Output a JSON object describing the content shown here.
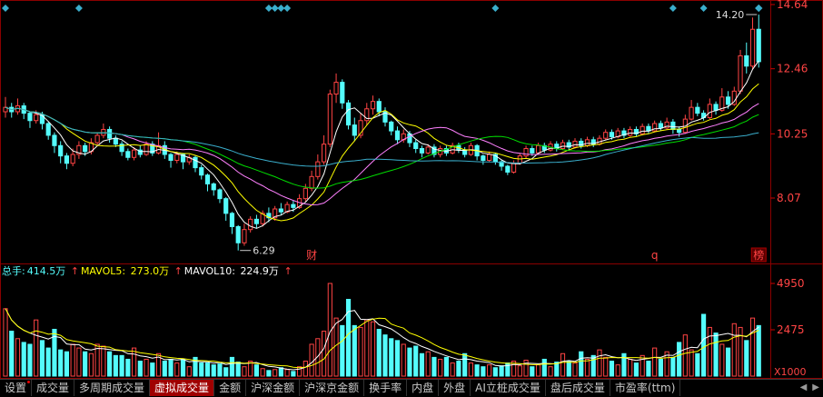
{
  "chart_data": {
    "type": "candlestick",
    "price_axis": {
      "ticks": [
        14.64,
        12.46,
        10.25,
        8.07
      ],
      "labels": [
        "14.64",
        "12.46",
        "10.25",
        "8.07"
      ]
    },
    "volume_axis": {
      "ticks": [
        4950,
        2475
      ],
      "labels": [
        "4950",
        "2475"
      ],
      "unit_label": "X1000"
    },
    "annotations": {
      "high_label": "14.20",
      "low_label": "6.29",
      "marker_cai": "财",
      "marker_q": "q",
      "marker_bang": "榜"
    },
    "colors": {
      "up": "#ff4444",
      "down": "#54fcfc",
      "ma5": "#ffffff",
      "ma10": "#ffff00",
      "ma20": "#ff80ff",
      "ma30": "#00dd00",
      "ma60": "#3aaecc"
    },
    "candles": [
      [
        11.0,
        11.15,
        11.5,
        10.8
      ],
      [
        11.15,
        11.0,
        11.3,
        10.8
      ],
      [
        11.0,
        11.2,
        11.45,
        10.9
      ],
      [
        11.2,
        10.95,
        11.3,
        10.75
      ],
      [
        10.95,
        10.7,
        11.0,
        10.45
      ],
      [
        10.7,
        10.9,
        11.05,
        10.6
      ],
      [
        10.9,
        10.6,
        11.0,
        10.4
      ],
      [
        10.6,
        10.2,
        10.65,
        10.05
      ],
      [
        10.2,
        9.85,
        10.3,
        9.6
      ],
      [
        9.85,
        9.5,
        10.0,
        9.25
      ],
      [
        9.5,
        9.25,
        9.6,
        9.05
      ],
      [
        9.25,
        9.55,
        9.75,
        9.15
      ],
      [
        9.55,
        9.85,
        10.0,
        9.4
      ],
      [
        9.85,
        9.65,
        9.95,
        9.5
      ],
      [
        9.65,
        9.95,
        10.1,
        9.55
      ],
      [
        9.95,
        10.2,
        10.3,
        9.85
      ],
      [
        10.2,
        10.4,
        10.6,
        10.1
      ],
      [
        10.4,
        10.1,
        10.5,
        9.95
      ],
      [
        10.1,
        9.9,
        10.2,
        9.8
      ],
      [
        9.9,
        9.65,
        10.0,
        9.5
      ],
      [
        9.65,
        9.45,
        9.75,
        9.35
      ],
      [
        9.45,
        9.7,
        9.8,
        9.35
      ],
      [
        9.7,
        9.55,
        9.85,
        9.45
      ],
      [
        9.55,
        9.9,
        10.0,
        9.5
      ],
      [
        9.9,
        9.6,
        10.0,
        9.5
      ],
      [
        9.6,
        9.85,
        10.3,
        9.55
      ],
      [
        9.85,
        9.55,
        10.0,
        9.4
      ],
      [
        9.55,
        9.35,
        9.6,
        9.1
      ],
      [
        9.35,
        9.55,
        9.65,
        9.25
      ],
      [
        9.55,
        9.3,
        9.6,
        9.05
      ],
      [
        9.3,
        9.45,
        9.55,
        9.2
      ],
      [
        9.45,
        9.1,
        9.5,
        8.95
      ],
      [
        9.1,
        8.85,
        9.2,
        8.7
      ],
      [
        8.85,
        8.55,
        8.9,
        8.3
      ],
      [
        8.55,
        8.35,
        8.6,
        8.15
      ],
      [
        8.35,
        8.05,
        8.4,
        7.9
      ],
      [
        8.05,
        7.55,
        8.1,
        7.3
      ],
      [
        7.55,
        7.1,
        7.6,
        6.85
      ],
      [
        7.1,
        6.55,
        7.15,
        6.29
      ],
      [
        6.55,
        7.0,
        7.2,
        6.45
      ],
      [
        7.0,
        7.35,
        7.45,
        6.9
      ],
      [
        7.35,
        7.2,
        7.5,
        7.05
      ],
      [
        7.2,
        7.55,
        7.65,
        7.1
      ],
      [
        7.55,
        7.4,
        7.75,
        7.25
      ],
      [
        7.4,
        7.7,
        7.8,
        7.3
      ],
      [
        7.7,
        7.6,
        7.9,
        7.5
      ],
      [
        7.6,
        7.85,
        7.95,
        7.55
      ],
      [
        7.85,
        7.75,
        8.0,
        7.6
      ],
      [
        7.75,
        8.05,
        8.2,
        7.7
      ],
      [
        8.05,
        8.4,
        8.55,
        7.95
      ],
      [
        8.4,
        8.8,
        9.0,
        8.3
      ],
      [
        8.8,
        9.3,
        9.55,
        8.7
      ],
      [
        9.3,
        9.9,
        10.2,
        9.2
      ],
      [
        9.9,
        11.6,
        11.75,
        9.8
      ],
      [
        11.6,
        12.0,
        12.3,
        11.3
      ],
      [
        12.0,
        11.3,
        12.1,
        11.1
      ],
      [
        11.3,
        10.55,
        11.4,
        10.4
      ],
      [
        10.55,
        10.2,
        10.8,
        10.0
      ],
      [
        10.2,
        10.7,
        10.95,
        10.1
      ],
      [
        10.7,
        11.1,
        11.3,
        10.55
      ],
      [
        11.1,
        11.35,
        11.55,
        10.9
      ],
      [
        11.35,
        11.0,
        11.45,
        10.85
      ],
      [
        11.0,
        10.65,
        11.15,
        10.5
      ],
      [
        10.65,
        10.35,
        10.7,
        10.2
      ],
      [
        10.35,
        10.05,
        10.5,
        9.9
      ],
      [
        10.05,
        10.25,
        10.4,
        9.95
      ],
      [
        10.25,
        9.95,
        10.35,
        9.8
      ],
      [
        9.95,
        9.75,
        10.05,
        9.6
      ],
      [
        9.75,
        9.6,
        9.85,
        9.45
      ],
      [
        9.6,
        9.8,
        9.9,
        9.55
      ],
      [
        9.8,
        9.55,
        9.9,
        9.45
      ],
      [
        9.55,
        9.75,
        9.85,
        9.45
      ],
      [
        9.75,
        9.6,
        9.85,
        9.5
      ],
      [
        9.6,
        9.85,
        9.95,
        9.55
      ],
      [
        9.85,
        9.7,
        9.95,
        9.6
      ],
      [
        9.7,
        9.55,
        9.8,
        9.45
      ],
      [
        9.55,
        9.85,
        9.95,
        9.5
      ],
      [
        9.85,
        9.5,
        9.9,
        9.35
      ],
      [
        9.5,
        9.35,
        9.55,
        9.2
      ],
      [
        9.35,
        9.55,
        9.65,
        9.3
      ],
      [
        9.55,
        9.3,
        9.6,
        9.2
      ],
      [
        9.3,
        9.15,
        9.35,
        9.0
      ],
      [
        9.15,
        8.95,
        9.2,
        8.85
      ],
      [
        8.95,
        9.25,
        9.35,
        8.9
      ],
      [
        9.25,
        9.5,
        9.6,
        9.2
      ],
      [
        9.5,
        9.75,
        9.85,
        9.4
      ],
      [
        9.75,
        9.6,
        9.85,
        9.5
      ],
      [
        9.6,
        9.85,
        9.95,
        9.55
      ],
      [
        9.85,
        9.7,
        9.95,
        9.6
      ],
      [
        9.7,
        9.9,
        10.0,
        9.65
      ],
      [
        9.9,
        9.75,
        10.0,
        9.65
      ],
      [
        9.75,
        9.95,
        10.05,
        9.7
      ],
      [
        9.95,
        9.8,
        10.05,
        9.7
      ],
      [
        9.8,
        10.0,
        10.1,
        9.75
      ],
      [
        10.0,
        9.85,
        10.1,
        9.75
      ],
      [
        9.85,
        10.05,
        10.15,
        9.8
      ],
      [
        10.05,
        9.9,
        10.15,
        9.8
      ],
      [
        9.9,
        10.1,
        10.2,
        9.85
      ],
      [
        10.1,
        10.3,
        10.4,
        10.05
      ],
      [
        10.3,
        10.15,
        10.4,
        10.05
      ],
      [
        10.15,
        10.35,
        10.45,
        10.1
      ],
      [
        10.35,
        10.2,
        10.45,
        10.1
      ],
      [
        10.2,
        10.4,
        10.5,
        10.15
      ],
      [
        10.4,
        10.25,
        10.5,
        10.15
      ],
      [
        10.25,
        10.5,
        10.6,
        10.2
      ],
      [
        10.5,
        10.35,
        10.6,
        10.25
      ],
      [
        10.35,
        10.6,
        10.7,
        10.3
      ],
      [
        10.6,
        10.45,
        10.7,
        10.35
      ],
      [
        10.45,
        10.65,
        10.8,
        10.4
      ],
      [
        10.65,
        10.4,
        10.75,
        10.25
      ],
      [
        10.4,
        10.3,
        10.5,
        10.15
      ],
      [
        10.3,
        10.75,
        10.9,
        10.25
      ],
      [
        10.75,
        11.15,
        11.4,
        10.7
      ],
      [
        11.15,
        10.95,
        11.3,
        10.85
      ],
      [
        10.95,
        10.8,
        11.05,
        10.7
      ],
      [
        10.8,
        11.25,
        11.45,
        10.75
      ],
      [
        11.25,
        11.05,
        11.35,
        10.9
      ],
      [
        11.05,
        11.5,
        11.8,
        11.0
      ],
      [
        11.5,
        11.25,
        11.7,
        11.1
      ],
      [
        11.25,
        11.7,
        11.85,
        11.2
      ],
      [
        11.7,
        12.9,
        13.1,
        11.6
      ],
      [
        12.9,
        12.55,
        13.35,
        12.3
      ],
      [
        12.55,
        13.8,
        14.2,
        12.45
      ],
      [
        13.8,
        12.7,
        14.3,
        12.5
      ]
    ],
    "volumes": [
      3600,
      2400,
      2000,
      1800,
      1700,
      3000,
      1900,
      1500,
      2500,
      1400,
      1300,
      1700,
      1500,
      1300,
      1200,
      1700,
      1600,
      1300,
      1100,
      1100,
      900,
      1500,
      800,
      900,
      700,
      1200,
      800,
      900,
      700,
      900,
      500,
      1000,
      700,
      700,
      600,
      650,
      450,
      1000,
      750,
      500,
      800,
      600,
      400,
      300,
      350,
      450,
      350,
      250,
      500,
      800,
      1700,
      2000,
      2400,
      4950,
      3100,
      2700,
      4100,
      2700,
      2600,
      3000,
      2900,
      2500,
      2200,
      2000,
      1900,
      1700,
      1500,
      1600,
      1200,
      1300,
      1000,
      900,
      1000,
      700,
      800,
      1200,
      700,
      600,
      500,
      600,
      450,
      550,
      700,
      800,
      550,
      850,
      500,
      600,
      900,
      500,
      750,
      1200,
      800,
      700,
      1300,
      900,
      1100,
      1400,
      1000,
      800,
      600,
      1200,
      900,
      700,
      1100,
      800,
      1500,
      900,
      1300,
      1000,
      1800,
      2200,
      1400,
      1200,
      3300,
      2600,
      2300,
      1700,
      1500,
      2800,
      2600,
      1900,
      3100,
      2700,
      4200
    ]
  },
  "markers_row": {
    "diamond_indices": [
      0,
      12,
      43,
      44,
      45,
      46,
      80,
      109,
      114,
      124,
      125,
      126,
      127
    ]
  },
  "info": {
    "total_label": "总手:",
    "total_value": "414.5万",
    "mavol5_label": "MAVOL5:",
    "mavol5_value": "273.0万",
    "mavol10_label": "MAVOL10:",
    "mavol10_value": "224.9万"
  },
  "tabs": [
    {
      "label": "设置",
      "active": false,
      "dot": true
    },
    {
      "label": "成交量",
      "active": false,
      "dot": false
    },
    {
      "label": "多周期成交量",
      "active": false,
      "dot": false
    },
    {
      "label": "虚拟成交量",
      "active": true,
      "dot": false
    },
    {
      "label": "金额",
      "active": false,
      "dot": false
    },
    {
      "label": "沪深金额",
      "active": false,
      "dot": false
    },
    {
      "label": "沪深京金额",
      "active": false,
      "dot": false
    },
    {
      "label": "换手率",
      "active": false,
      "dot": false
    },
    {
      "label": "内盘",
      "active": false,
      "dot": false
    },
    {
      "label": "外盘",
      "active": false,
      "dot": false
    },
    {
      "label": "AI立桩成交量",
      "active": false,
      "dot": false
    },
    {
      "label": "盘后成交量",
      "active": false,
      "dot": false
    },
    {
      "label": "市盈率(ttm)",
      "active": false,
      "dot": false
    }
  ]
}
